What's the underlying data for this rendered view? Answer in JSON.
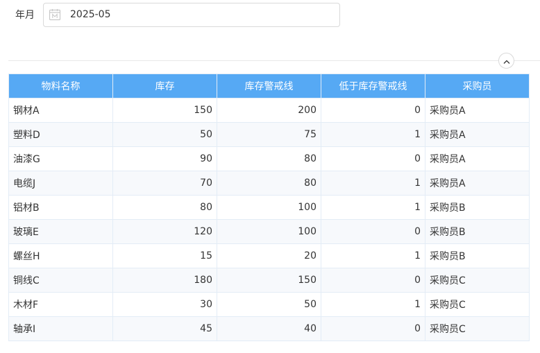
{
  "filter": {
    "label": "年月",
    "value": "2025-05",
    "icon": "calendar-icon"
  },
  "collapse": {
    "icon": "chevron-up-icon"
  },
  "colors": {
    "header_bg": "#56a9f4",
    "header_text": "#ffffff",
    "border": "#e3ecf6",
    "stripe": "#f7f9fc"
  },
  "table": {
    "columns": [
      "物料名称",
      "库存",
      "库存警戒线",
      "低于库存警戒线",
      "采购员"
    ],
    "rows": [
      [
        "钢材A",
        "150",
        "200",
        "0",
        "采购员A"
      ],
      [
        "塑料D",
        "50",
        "75",
        "1",
        "采购员A"
      ],
      [
        "油漆G",
        "90",
        "80",
        "0",
        "采购员A"
      ],
      [
        "电缆J",
        "70",
        "80",
        "1",
        "采购员A"
      ],
      [
        "铝材B",
        "80",
        "100",
        "1",
        "采购员B"
      ],
      [
        "玻璃E",
        "120",
        "100",
        "0",
        "采购员B"
      ],
      [
        "螺丝H",
        "15",
        "20",
        "1",
        "采购员B"
      ],
      [
        "铜线C",
        "180",
        "150",
        "0",
        "采购员C"
      ],
      [
        "木材F",
        "30",
        "50",
        "1",
        "采购员C"
      ],
      [
        "轴承I",
        "45",
        "40",
        "0",
        "采购员C"
      ]
    ]
  }
}
